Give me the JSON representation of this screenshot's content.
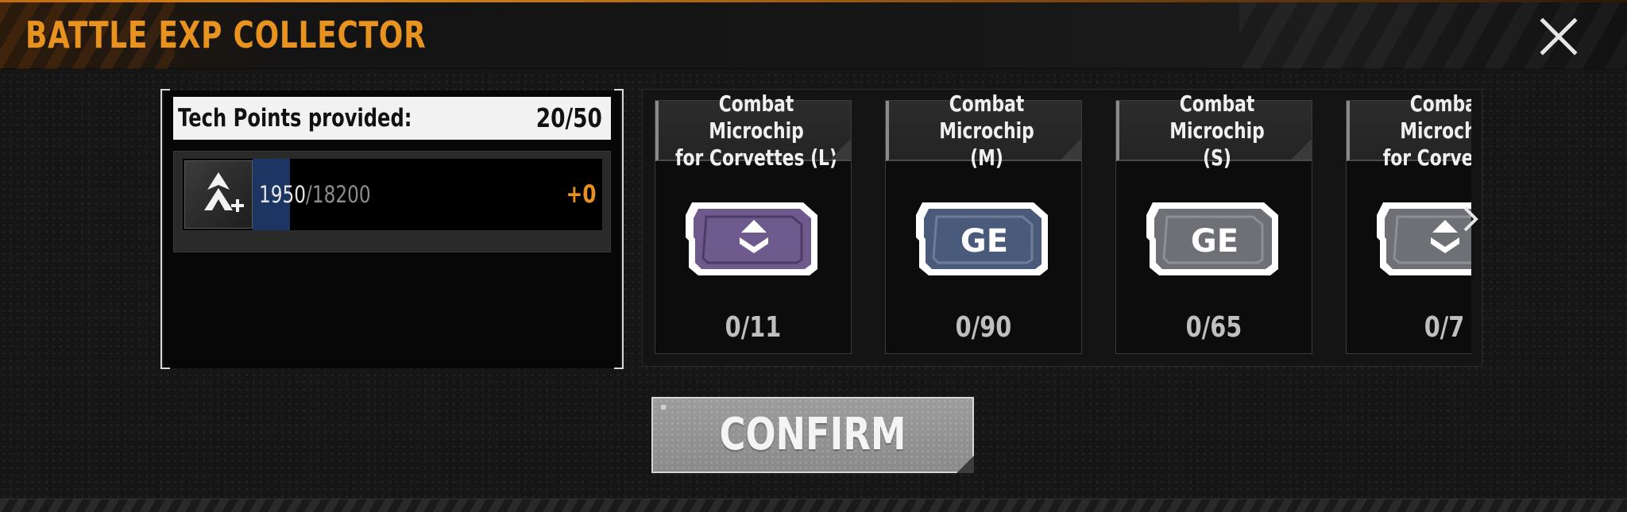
{
  "header": {
    "title": "BATTLE EXP COLLECTOR",
    "close_icon": "close-icon"
  },
  "tech_points": {
    "label": "Tech Points provided:",
    "value": "20/50"
  },
  "exp": {
    "icon": "rank-up-icon",
    "current": "1950",
    "max": "/18200",
    "fill_fraction": 0.107,
    "gain": "+0"
  },
  "cards": [
    {
      "title": "Combat Microchip\nfor Corvettes (L)",
      "count": "0/11",
      "chip": "chevron-chip-icon",
      "color": "#6e5a8c"
    },
    {
      "title": "Combat Microchip\n(M)",
      "count": "0/90",
      "chip": "ge-chip-icon",
      "color": "#4a5a7a"
    },
    {
      "title": "Combat Microchip\n(S)",
      "count": "0/65",
      "chip": "ge-chip-icon",
      "color": "#6f7075"
    },
    {
      "title": "Combat Microchip\nfor Corvettes",
      "count": "0/7",
      "chip": "chevron-chip-icon",
      "color": "#6f7075"
    }
  ],
  "chip_text": "GE",
  "confirm_label": "CONFIRM",
  "colors": {
    "accent": "#e8921f",
    "exp_fill": "#1d3563"
  }
}
